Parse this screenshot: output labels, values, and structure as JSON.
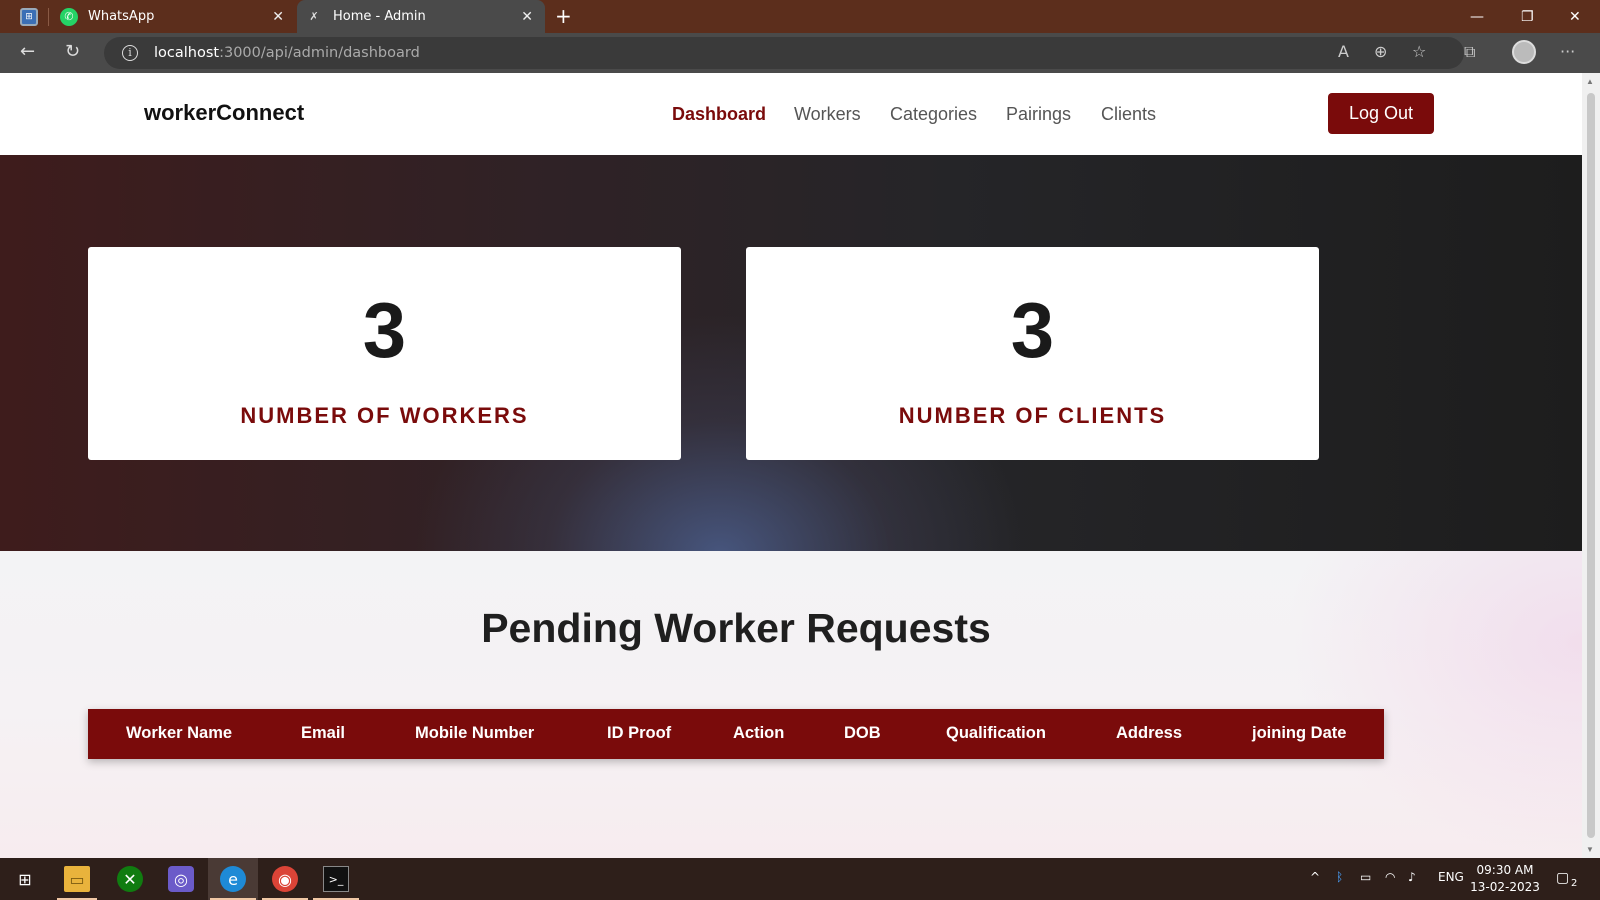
{
  "browser": {
    "tabs": [
      {
        "title": "WhatsApp",
        "icon": "whatsapp-icon",
        "active": false
      },
      {
        "title": "Home - Admin",
        "icon": "site-icon",
        "active": true
      }
    ],
    "url_host": "localhost",
    "url_rest": ":3000/api/admin/dashboard"
  },
  "header": {
    "brand": "workerConnect",
    "nav": [
      "Dashboard",
      "Workers",
      "Categories",
      "Pairings",
      "Clients"
    ],
    "active_nav": "Dashboard",
    "logout_label": "Log Out"
  },
  "stats": [
    {
      "value": "3",
      "label": "NUMBER OF WORKERS"
    },
    {
      "value": "3",
      "label": "NUMBER OF CLIENTS"
    }
  ],
  "pending": {
    "title": "Pending Worker Requests",
    "columns": [
      "Worker Name",
      "Email",
      "Mobile Number",
      "ID Proof",
      "Action",
      "DOB",
      "Qualification",
      "Address",
      "joining Date"
    ]
  },
  "taskbar": {
    "tray_lang": "ENG",
    "time": "09:30 AM",
    "date": "13-02-2023",
    "notification_count": "2"
  },
  "colors": {
    "accent": "#7a0b0b",
    "tabbar": "#5c2e1c",
    "taskbar": "#2e1f1a"
  }
}
